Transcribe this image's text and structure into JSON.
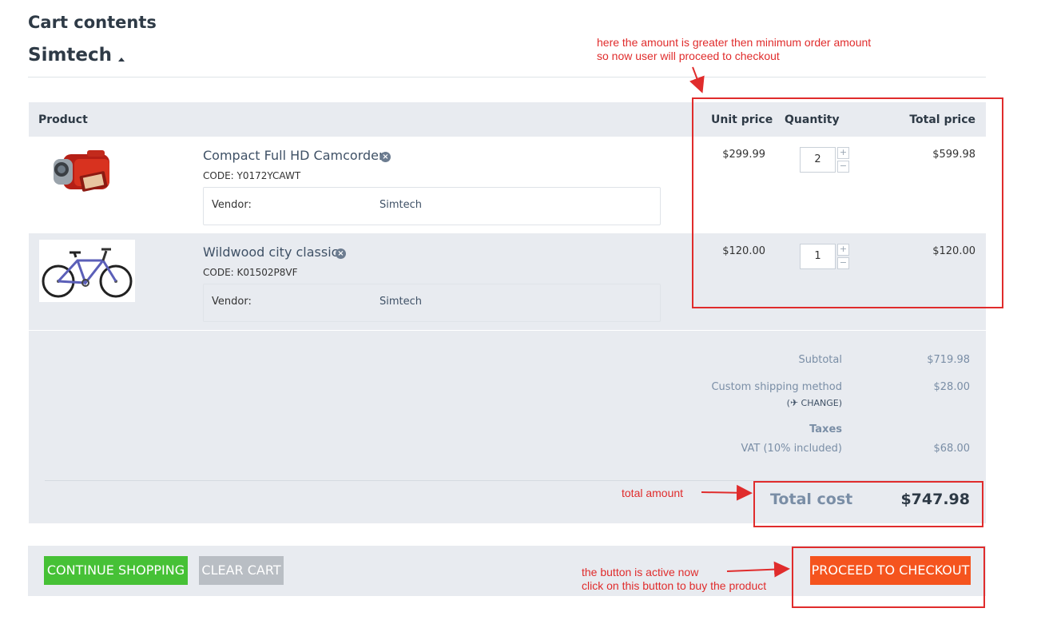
{
  "page": {
    "title": "Cart contents",
    "vendor_title": "Simtech"
  },
  "table": {
    "headers": {
      "product": "Product",
      "unit_price": "Unit price",
      "quantity": "Quantity",
      "total_price": "Total price"
    },
    "items": [
      {
        "name": "Compact Full HD Camcorder",
        "code": "CODE: Y0172YCAWT",
        "vendor_label": "Vendor:",
        "vendor_value": "Simtech",
        "unit_price": "$299.99",
        "quantity": "2",
        "total_price": "$599.98",
        "image": "red-camcorder"
      },
      {
        "name": "Wildwood city classic",
        "code": "CODE: K01502P8VF",
        "vendor_label": "Vendor:",
        "vendor_value": "Simtech",
        "unit_price": "$120.00",
        "quantity": "1",
        "total_price": "$120.00",
        "image": "blue-bicycle"
      }
    ],
    "qty_plus": "+",
    "qty_minus": "−",
    "remove_glyph": "×"
  },
  "summary": {
    "subtotal_label": "Subtotal",
    "subtotal_value": "$719.98",
    "shipping_label": "Custom shipping method",
    "shipping_value": "$28.00",
    "change_label": "CHANGE",
    "taxes_label": "Taxes",
    "vat_label": "VAT (10% included)",
    "vat_value": "$68.00",
    "total_label": "Total cost",
    "total_value": "$747.98"
  },
  "actions": {
    "continue_label": "CONTINUE SHOPPING",
    "clear_label": "CLEAR CART",
    "checkout_label": "PROCEED TO CHECKOUT"
  },
  "annotations": {
    "min_order_line1": "here the amount is greater then minimum order amount",
    "min_order_line2": "so now user will proceed to checkout",
    "total_amount": "total amount",
    "button_line1": "the button is active now",
    "button_line2": "click on this button to buy the product"
  },
  "colors": {
    "accent_green": "#46c136",
    "accent_orange": "#f5541e",
    "annotation_red": "#e02c2c",
    "muted_gray": "#b9bec4"
  }
}
